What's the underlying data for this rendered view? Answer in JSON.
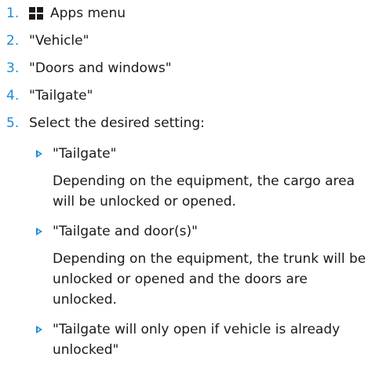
{
  "steps": [
    {
      "num": "1.",
      "text": "Apps menu"
    },
    {
      "num": "2.",
      "text": "\"Vehicle\""
    },
    {
      "num": "3.",
      "text": "\"Doors and windows\""
    },
    {
      "num": "4.",
      "text": "\"Tailgate\""
    },
    {
      "num": "5.",
      "text": "Select the desired setting:"
    }
  ],
  "options": [
    {
      "label": "\"Tailgate\"",
      "description": "Depending on the equipment, the cargo area will be unlocked or opened."
    },
    {
      "label": "\"Tailgate and door(s)\"",
      "description": "Depending on the equipment, the trunk will be unlocked or opened and the doors are unlocked."
    },
    {
      "label": "\"Tailgate will only open if vehicle is already unlocked\""
    }
  ],
  "colors": {
    "accent": "#1a8cd8",
    "text": "#1a1a1a"
  },
  "icons": {
    "apps_menu": "apps-grid-icon",
    "option_bullet": "triangle-bullet-icon"
  }
}
